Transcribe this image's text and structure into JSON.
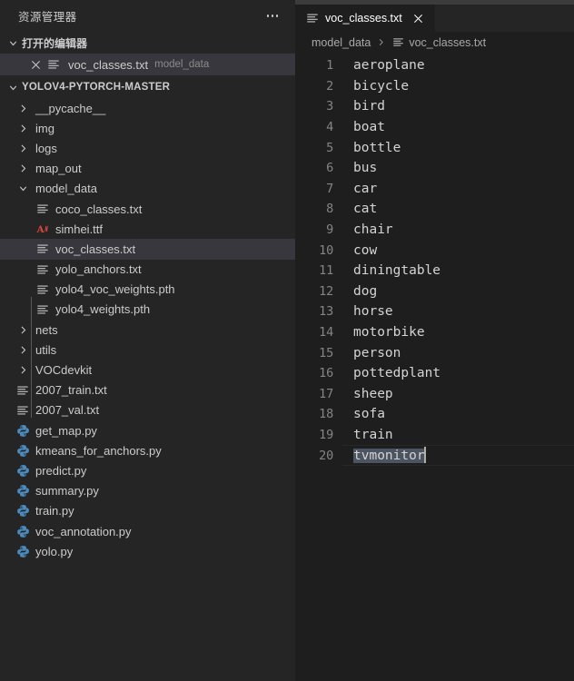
{
  "sidebar": {
    "title": "资源管理器",
    "more_label": "…",
    "open_editors": {
      "section_label": "打开的编辑器",
      "items": [
        {
          "name": "voc_classes.txt",
          "description": "model_data",
          "icon": "text-file-icon",
          "active": true
        }
      ]
    },
    "workspace": {
      "root_label": "YOLOV4-PYTORCH-MASTER",
      "items": [
        {
          "label": "__pycache__",
          "type": "folder",
          "expanded": false,
          "depth": 1,
          "icon": "chevron-right-icon"
        },
        {
          "label": "img",
          "type": "folder",
          "expanded": false,
          "depth": 1,
          "icon": "chevron-right-icon"
        },
        {
          "label": "logs",
          "type": "folder",
          "expanded": false,
          "depth": 1,
          "icon": "chevron-right-icon"
        },
        {
          "label": "map_out",
          "type": "folder",
          "expanded": false,
          "depth": 1,
          "icon": "chevron-right-icon"
        },
        {
          "label": "model_data",
          "type": "folder",
          "expanded": true,
          "depth": 1,
          "icon": "chevron-down-icon"
        },
        {
          "label": "coco_classes.txt",
          "type": "file",
          "filetype": "text",
          "depth": 2,
          "icon": "text-file-icon"
        },
        {
          "label": "simhei.ttf",
          "type": "file",
          "filetype": "font",
          "depth": 2,
          "icon": "font-file-icon"
        },
        {
          "label": "voc_classes.txt",
          "type": "file",
          "filetype": "text",
          "depth": 2,
          "icon": "text-file-icon",
          "selected": true
        },
        {
          "label": "yolo_anchors.txt",
          "type": "file",
          "filetype": "text",
          "depth": 2,
          "icon": "text-file-icon"
        },
        {
          "label": "yolo4_voc_weights.pth",
          "type": "file",
          "filetype": "text",
          "depth": 2,
          "icon": "text-file-icon"
        },
        {
          "label": "yolo4_weights.pth",
          "type": "file",
          "filetype": "text",
          "depth": 2,
          "icon": "text-file-icon"
        },
        {
          "label": "nets",
          "type": "folder",
          "expanded": false,
          "depth": 1,
          "icon": "chevron-right-icon"
        },
        {
          "label": "utils",
          "type": "folder",
          "expanded": false,
          "depth": 1,
          "icon": "chevron-right-icon"
        },
        {
          "label": "VOCdevkit",
          "type": "folder",
          "expanded": false,
          "depth": 1,
          "icon": "chevron-right-icon"
        },
        {
          "label": "2007_train.txt",
          "type": "file",
          "filetype": "text",
          "depth": 1,
          "icon": "text-file-icon"
        },
        {
          "label": "2007_val.txt",
          "type": "file",
          "filetype": "text",
          "depth": 1,
          "icon": "text-file-icon"
        },
        {
          "label": "get_map.py",
          "type": "file",
          "filetype": "python",
          "depth": 1,
          "icon": "python-file-icon"
        },
        {
          "label": "kmeans_for_anchors.py",
          "type": "file",
          "filetype": "python",
          "depth": 1,
          "icon": "python-file-icon"
        },
        {
          "label": "predict.py",
          "type": "file",
          "filetype": "python",
          "depth": 1,
          "icon": "python-file-icon"
        },
        {
          "label": "summary.py",
          "type": "file",
          "filetype": "python",
          "depth": 1,
          "icon": "python-file-icon"
        },
        {
          "label": "train.py",
          "type": "file",
          "filetype": "python",
          "depth": 1,
          "icon": "python-file-icon"
        },
        {
          "label": "voc_annotation.py",
          "type": "file",
          "filetype": "python",
          "depth": 1,
          "icon": "python-file-icon"
        },
        {
          "label": "yolo.py",
          "type": "file",
          "filetype": "python",
          "depth": 1,
          "icon": "python-file-icon"
        }
      ]
    }
  },
  "editor": {
    "tabs": [
      {
        "label": "voc_classes.txt",
        "icon": "text-file-icon",
        "close_label": "×",
        "active": true
      }
    ],
    "breadcrumb": [
      {
        "label": "model_data",
        "icon": null
      },
      {
        "label": "voc_classes.txt",
        "icon": "text-file-icon"
      }
    ],
    "lines": [
      {
        "n": 1,
        "text": "aeroplane"
      },
      {
        "n": 2,
        "text": "bicycle"
      },
      {
        "n": 3,
        "text": "bird"
      },
      {
        "n": 4,
        "text": "boat"
      },
      {
        "n": 5,
        "text": "bottle"
      },
      {
        "n": 6,
        "text": "bus"
      },
      {
        "n": 7,
        "text": "car"
      },
      {
        "n": 8,
        "text": "cat"
      },
      {
        "n": 9,
        "text": "chair"
      },
      {
        "n": 10,
        "text": "cow"
      },
      {
        "n": 11,
        "text": "diningtable"
      },
      {
        "n": 12,
        "text": "dog"
      },
      {
        "n": 13,
        "text": "horse"
      },
      {
        "n": 14,
        "text": "motorbike"
      },
      {
        "n": 15,
        "text": "person"
      },
      {
        "n": 16,
        "text": "pottedplant"
      },
      {
        "n": 17,
        "text": "sheep"
      },
      {
        "n": 18,
        "text": "sofa"
      },
      {
        "n": 19,
        "text": "train"
      },
      {
        "n": 20,
        "text": "tvmonitor",
        "selected": true,
        "cursor": true
      }
    ]
  },
  "colors": {
    "sidebar_bg": "#252526",
    "editor_bg": "#1e1e1e",
    "row_selected_bg": "#37373d",
    "selection_bg": "#4b5460",
    "text": "#cccccc",
    "code_text": "#d4d4d4",
    "line_number": "#858585",
    "python_icon": "#4b8bbe",
    "font_icon": "#d4453a"
  }
}
